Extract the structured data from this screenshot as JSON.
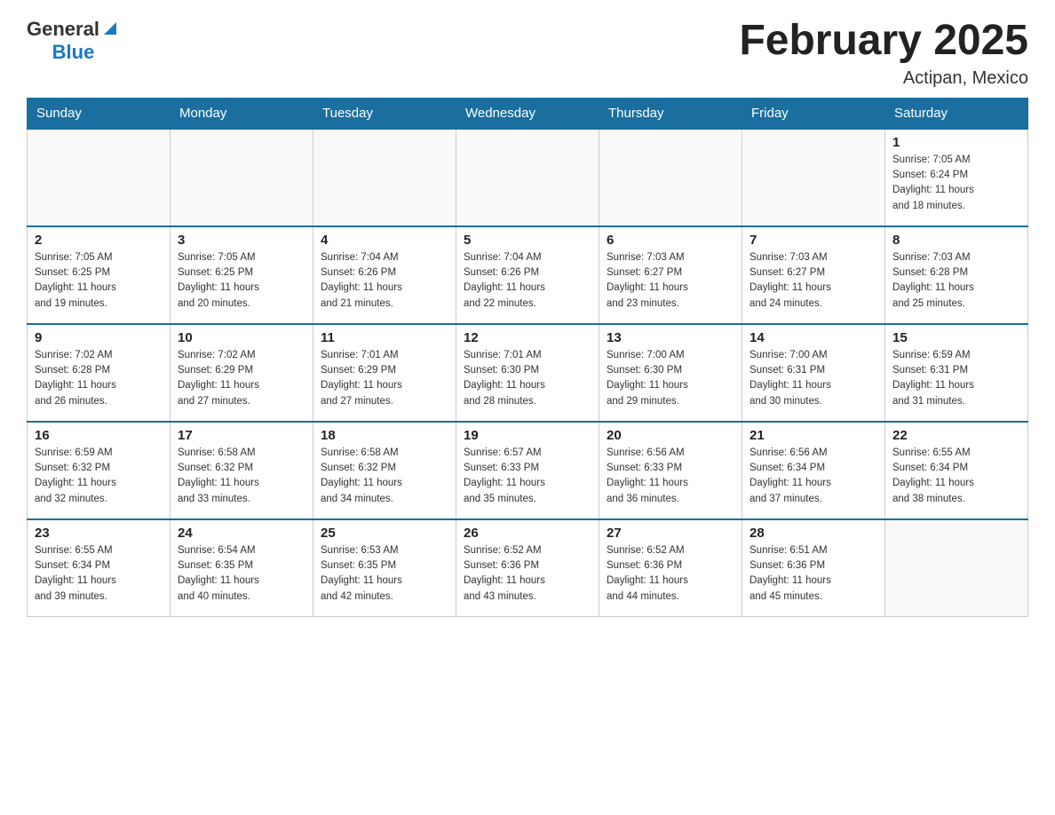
{
  "header": {
    "logo_general": "General",
    "logo_blue": "Blue",
    "month_title": "February 2025",
    "location": "Actipan, Mexico"
  },
  "days_of_week": [
    "Sunday",
    "Monday",
    "Tuesday",
    "Wednesday",
    "Thursday",
    "Friday",
    "Saturday"
  ],
  "weeks": [
    [
      {
        "day": "",
        "info": ""
      },
      {
        "day": "",
        "info": ""
      },
      {
        "day": "",
        "info": ""
      },
      {
        "day": "",
        "info": ""
      },
      {
        "day": "",
        "info": ""
      },
      {
        "day": "",
        "info": ""
      },
      {
        "day": "1",
        "info": "Sunrise: 7:05 AM\nSunset: 6:24 PM\nDaylight: 11 hours\nand 18 minutes."
      }
    ],
    [
      {
        "day": "2",
        "info": "Sunrise: 7:05 AM\nSunset: 6:25 PM\nDaylight: 11 hours\nand 19 minutes."
      },
      {
        "day": "3",
        "info": "Sunrise: 7:05 AM\nSunset: 6:25 PM\nDaylight: 11 hours\nand 20 minutes."
      },
      {
        "day": "4",
        "info": "Sunrise: 7:04 AM\nSunset: 6:26 PM\nDaylight: 11 hours\nand 21 minutes."
      },
      {
        "day": "5",
        "info": "Sunrise: 7:04 AM\nSunset: 6:26 PM\nDaylight: 11 hours\nand 22 minutes."
      },
      {
        "day": "6",
        "info": "Sunrise: 7:03 AM\nSunset: 6:27 PM\nDaylight: 11 hours\nand 23 minutes."
      },
      {
        "day": "7",
        "info": "Sunrise: 7:03 AM\nSunset: 6:27 PM\nDaylight: 11 hours\nand 24 minutes."
      },
      {
        "day": "8",
        "info": "Sunrise: 7:03 AM\nSunset: 6:28 PM\nDaylight: 11 hours\nand 25 minutes."
      }
    ],
    [
      {
        "day": "9",
        "info": "Sunrise: 7:02 AM\nSunset: 6:28 PM\nDaylight: 11 hours\nand 26 minutes."
      },
      {
        "day": "10",
        "info": "Sunrise: 7:02 AM\nSunset: 6:29 PM\nDaylight: 11 hours\nand 27 minutes."
      },
      {
        "day": "11",
        "info": "Sunrise: 7:01 AM\nSunset: 6:29 PM\nDaylight: 11 hours\nand 27 minutes."
      },
      {
        "day": "12",
        "info": "Sunrise: 7:01 AM\nSunset: 6:30 PM\nDaylight: 11 hours\nand 28 minutes."
      },
      {
        "day": "13",
        "info": "Sunrise: 7:00 AM\nSunset: 6:30 PM\nDaylight: 11 hours\nand 29 minutes."
      },
      {
        "day": "14",
        "info": "Sunrise: 7:00 AM\nSunset: 6:31 PM\nDaylight: 11 hours\nand 30 minutes."
      },
      {
        "day": "15",
        "info": "Sunrise: 6:59 AM\nSunset: 6:31 PM\nDaylight: 11 hours\nand 31 minutes."
      }
    ],
    [
      {
        "day": "16",
        "info": "Sunrise: 6:59 AM\nSunset: 6:32 PM\nDaylight: 11 hours\nand 32 minutes."
      },
      {
        "day": "17",
        "info": "Sunrise: 6:58 AM\nSunset: 6:32 PM\nDaylight: 11 hours\nand 33 minutes."
      },
      {
        "day": "18",
        "info": "Sunrise: 6:58 AM\nSunset: 6:32 PM\nDaylight: 11 hours\nand 34 minutes."
      },
      {
        "day": "19",
        "info": "Sunrise: 6:57 AM\nSunset: 6:33 PM\nDaylight: 11 hours\nand 35 minutes."
      },
      {
        "day": "20",
        "info": "Sunrise: 6:56 AM\nSunset: 6:33 PM\nDaylight: 11 hours\nand 36 minutes."
      },
      {
        "day": "21",
        "info": "Sunrise: 6:56 AM\nSunset: 6:34 PM\nDaylight: 11 hours\nand 37 minutes."
      },
      {
        "day": "22",
        "info": "Sunrise: 6:55 AM\nSunset: 6:34 PM\nDaylight: 11 hours\nand 38 minutes."
      }
    ],
    [
      {
        "day": "23",
        "info": "Sunrise: 6:55 AM\nSunset: 6:34 PM\nDaylight: 11 hours\nand 39 minutes."
      },
      {
        "day": "24",
        "info": "Sunrise: 6:54 AM\nSunset: 6:35 PM\nDaylight: 11 hours\nand 40 minutes."
      },
      {
        "day": "25",
        "info": "Sunrise: 6:53 AM\nSunset: 6:35 PM\nDaylight: 11 hours\nand 42 minutes."
      },
      {
        "day": "26",
        "info": "Sunrise: 6:52 AM\nSunset: 6:36 PM\nDaylight: 11 hours\nand 43 minutes."
      },
      {
        "day": "27",
        "info": "Sunrise: 6:52 AM\nSunset: 6:36 PM\nDaylight: 11 hours\nand 44 minutes."
      },
      {
        "day": "28",
        "info": "Sunrise: 6:51 AM\nSunset: 6:36 PM\nDaylight: 11 hours\nand 45 minutes."
      },
      {
        "day": "",
        "info": ""
      }
    ]
  ]
}
